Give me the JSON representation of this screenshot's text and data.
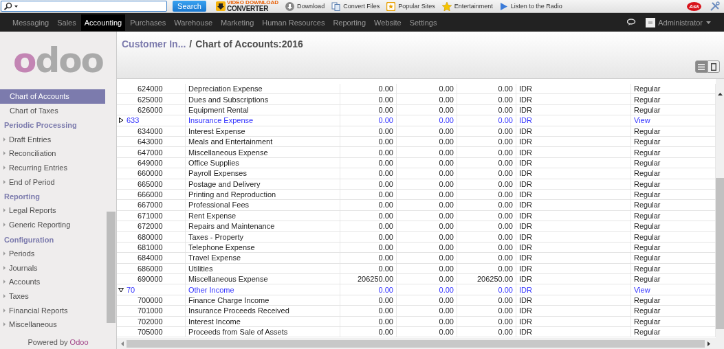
{
  "browser_toolbar": {
    "search_button": "Search",
    "logo": {
      "top": "VIDEO DOWNLOAD",
      "bottom": "CONVERTER"
    },
    "links": [
      {
        "kind": "download",
        "label": "Download"
      },
      {
        "kind": "convert",
        "label": "Convert Files"
      },
      {
        "kind": "star-box",
        "label": "Popular Sites"
      },
      {
        "kind": "star",
        "label": "Entertainment"
      },
      {
        "kind": "play",
        "label": "Listen to the Radio"
      }
    ],
    "ask_logo": "Ask"
  },
  "menu": {
    "items": [
      {
        "label": "Messaging",
        "selected": false
      },
      {
        "label": "Sales",
        "selected": false
      },
      {
        "label": "Accounting",
        "selected": true
      },
      {
        "label": "Purchases",
        "selected": false
      },
      {
        "label": "Warehouse",
        "selected": false
      },
      {
        "label": "Marketing",
        "selected": false
      },
      {
        "label": "Human Resources",
        "selected": false
      },
      {
        "label": "Reporting",
        "selected": false
      },
      {
        "label": "Website",
        "selected": false
      },
      {
        "label": "Settings",
        "selected": false
      }
    ],
    "user": "Administrator"
  },
  "sidebar": {
    "logo": "odoo",
    "sections": [
      {
        "items": [
          {
            "label": "Chart of Accounts",
            "selected": true,
            "expandable": false
          },
          {
            "label": "Chart of Taxes",
            "selected": false,
            "expandable": false
          }
        ]
      },
      {
        "title": "Periodic Processing",
        "items": [
          {
            "label": "Draft Entries",
            "selected": false,
            "expandable": true
          },
          {
            "label": "Reconciliation",
            "selected": false,
            "expandable": true
          },
          {
            "label": "Recurring Entries",
            "selected": false,
            "expandable": true
          },
          {
            "label": "End of Period",
            "selected": false,
            "expandable": true
          }
        ]
      },
      {
        "title": "Reporting",
        "items": [
          {
            "label": "Legal Reports",
            "selected": false,
            "expandable": true
          },
          {
            "label": "Generic Reporting",
            "selected": false,
            "expandable": true
          }
        ]
      },
      {
        "title": "Configuration",
        "items": [
          {
            "label": "Periods",
            "selected": false,
            "expandable": true
          },
          {
            "label": "Journals",
            "selected": false,
            "expandable": true
          },
          {
            "label": "Accounts",
            "selected": false,
            "expandable": true
          },
          {
            "label": "Taxes",
            "selected": false,
            "expandable": true
          },
          {
            "label": "Financial Reports",
            "selected": false,
            "expandable": true
          },
          {
            "label": "Miscellaneous",
            "selected": false,
            "expandable": true
          }
        ]
      }
    ],
    "footer": {
      "text": "Powered by",
      "link": "Odoo"
    }
  },
  "breadcrumb": {
    "parent": "Customer In...",
    "separator": "/",
    "current": "Chart of Accounts:2016"
  },
  "view_switcher": [
    {
      "kind": "list",
      "selected": true
    },
    {
      "kind": "form",
      "selected": false
    }
  ],
  "table": {
    "rows": [
      {
        "kind": "account",
        "cells": [
          "624000",
          "Depreciation Expense",
          "0.00",
          "0.00",
          "0.00",
          "IDR",
          "Regular"
        ]
      },
      {
        "kind": "account",
        "cells": [
          "625000",
          "Dues and Subscriptions",
          "0.00",
          "0.00",
          "0.00",
          "IDR",
          "Regular"
        ]
      },
      {
        "kind": "account",
        "cells": [
          "626000",
          "Equipment Rental",
          "0.00",
          "0.00",
          "0.00",
          "IDR",
          "Regular"
        ]
      },
      {
        "kind": "view",
        "expanded": false,
        "cells": [
          "633",
          "Insurance Expense",
          "0.00",
          "0.00",
          "0.00",
          "IDR",
          "View"
        ]
      },
      {
        "kind": "account",
        "cells": [
          "634000",
          "Interest Expense",
          "0.00",
          "0.00",
          "0.00",
          "IDR",
          "Regular"
        ]
      },
      {
        "kind": "account",
        "cells": [
          "643000",
          "Meals and Entertainment",
          "0.00",
          "0.00",
          "0.00",
          "IDR",
          "Regular"
        ]
      },
      {
        "kind": "account",
        "cells": [
          "647000",
          "Miscellaneous Expense",
          "0.00",
          "0.00",
          "0.00",
          "IDR",
          "Regular"
        ]
      },
      {
        "kind": "account",
        "cells": [
          "649000",
          "Office Supplies",
          "0.00",
          "0.00",
          "0.00",
          "IDR",
          "Regular"
        ]
      },
      {
        "kind": "account",
        "cells": [
          "660000",
          "Payroll Expenses",
          "0.00",
          "0.00",
          "0.00",
          "IDR",
          "Regular"
        ]
      },
      {
        "kind": "account",
        "cells": [
          "665000",
          "Postage and Delivery",
          "0.00",
          "0.00",
          "0.00",
          "IDR",
          "Regular"
        ]
      },
      {
        "kind": "account",
        "cells": [
          "666000",
          "Printing and Reproduction",
          "0.00",
          "0.00",
          "0.00",
          "IDR",
          "Regular"
        ]
      },
      {
        "kind": "account",
        "cells": [
          "667000",
          "Professional Fees",
          "0.00",
          "0.00",
          "0.00",
          "IDR",
          "Regular"
        ]
      },
      {
        "kind": "account",
        "cells": [
          "671000",
          "Rent Expense",
          "0.00",
          "0.00",
          "0.00",
          "IDR",
          "Regular"
        ]
      },
      {
        "kind": "account",
        "cells": [
          "672000",
          "Repairs and Maintenance",
          "0.00",
          "0.00",
          "0.00",
          "IDR",
          "Regular"
        ]
      },
      {
        "kind": "account",
        "cells": [
          "680000",
          "Taxes - Property",
          "0.00",
          "0.00",
          "0.00",
          "IDR",
          "Regular"
        ]
      },
      {
        "kind": "account",
        "cells": [
          "681000",
          "Telephone Expense",
          "0.00",
          "0.00",
          "0.00",
          "IDR",
          "Regular"
        ]
      },
      {
        "kind": "account",
        "cells": [
          "684000",
          "Travel Expense",
          "0.00",
          "0.00",
          "0.00",
          "IDR",
          "Regular"
        ]
      },
      {
        "kind": "account",
        "cells": [
          "686000",
          "Utilities",
          "0.00",
          "0.00",
          "0.00",
          "IDR",
          "Regular"
        ]
      },
      {
        "kind": "account",
        "cells": [
          "690000",
          "Miscellaneous Expense",
          "206250.00",
          "0.00",
          "206250.00",
          "IDR",
          "Regular"
        ]
      },
      {
        "kind": "view",
        "expanded": true,
        "cells": [
          "70",
          "Other Income",
          "0.00",
          "0.00",
          "0.00",
          "IDR",
          "View"
        ]
      },
      {
        "kind": "account",
        "cells": [
          "700000",
          "Finance Charge Income",
          "0.00",
          "0.00",
          "0.00",
          "IDR",
          "Regular"
        ]
      },
      {
        "kind": "account",
        "cells": [
          "701000",
          "Insurance Proceeds Received",
          "0.00",
          "0.00",
          "0.00",
          "IDR",
          "Regular"
        ]
      },
      {
        "kind": "account",
        "cells": [
          "702000",
          "Interest Income",
          "0.00",
          "0.00",
          "0.00",
          "IDR",
          "Regular"
        ]
      },
      {
        "kind": "account",
        "cells": [
          "705000",
          "Proceeds from Sale of Assets",
          "0.00",
          "0.00",
          "0.00",
          "IDR",
          "Regular"
        ]
      }
    ]
  }
}
